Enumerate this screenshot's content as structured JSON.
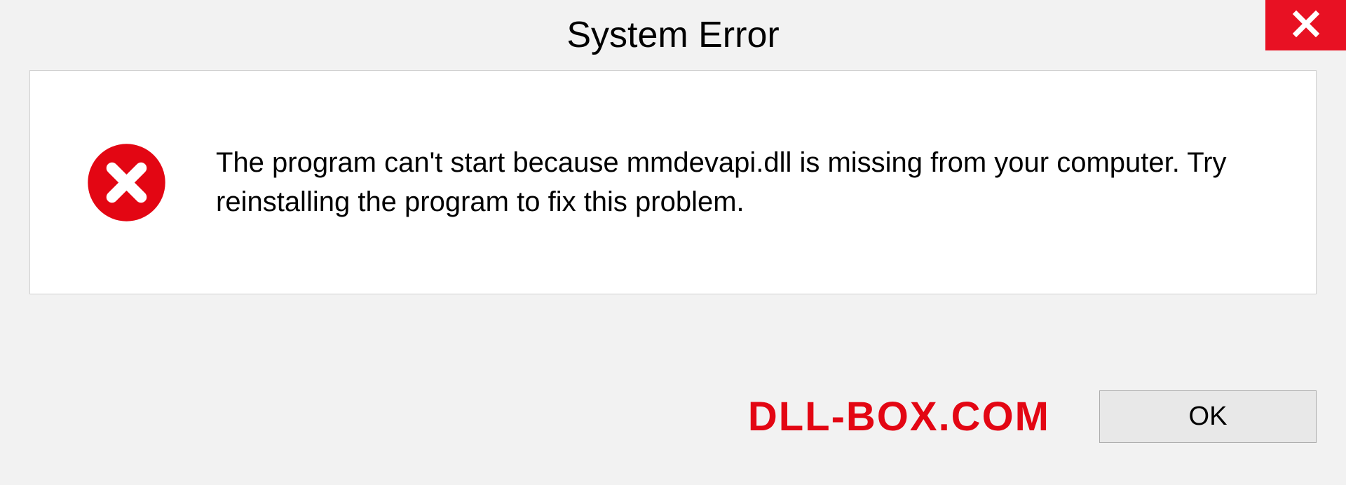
{
  "dialog": {
    "title": "System Error",
    "message": "The program can't start because mmdevapi.dll is missing from your computer. Try reinstalling the program to fix this problem.",
    "ok_label": "OK"
  },
  "watermark": "DLL-BOX.COM",
  "colors": {
    "close_bg": "#e81123",
    "error_red": "#e30613",
    "window_bg": "#f2f2f2"
  }
}
